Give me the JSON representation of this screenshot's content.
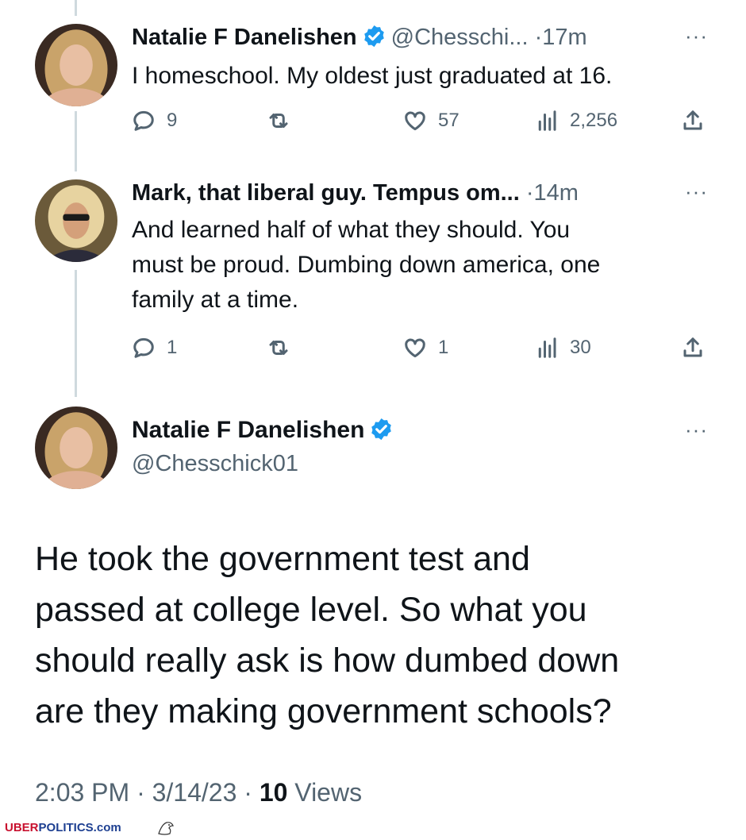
{
  "tweets": [
    {
      "name": "Natalie F Danelishen",
      "handle": "@Chesschi...",
      "separator": "·",
      "time": "17m",
      "text": "I homeschool. My oldest just graduated at 16.",
      "replies": "9",
      "retweets": "",
      "likes": "57",
      "views": "2,256"
    },
    {
      "name": "Mark, that liberal guy. Tempus om...",
      "separator": "·",
      "time": "14m",
      "text_lines": [
        "And learned half of what they should. You",
        "must be proud. Dumbing down america, one",
        "family at a time."
      ],
      "replies": "1",
      "retweets": "",
      "likes": "1",
      "views": "30"
    }
  ],
  "main_tweet": {
    "name": "Natalie F Danelishen",
    "handle": "@Chesschick01",
    "text_lines": [
      "He took the government test and",
      "passed at college level. So what you",
      "should really ask is how dumbed down",
      "are they making government schools?"
    ],
    "time": "2:03 PM",
    "date": "3/14/23",
    "separator": "·",
    "views_count": "10",
    "views_label": "Views"
  },
  "more_label": "···",
  "watermark": {
    "part1": "UBER",
    "part2": "POLITICS.com"
  },
  "colors": {
    "verified": "#1d9bf0",
    "text": "#0f1419",
    "secondary": "#536471",
    "thread_line": "#cfd9de"
  },
  "icons": [
    "reply-icon",
    "retweet-icon",
    "like-icon",
    "views-icon",
    "share-icon",
    "verified-badge-icon",
    "more-icon"
  ]
}
